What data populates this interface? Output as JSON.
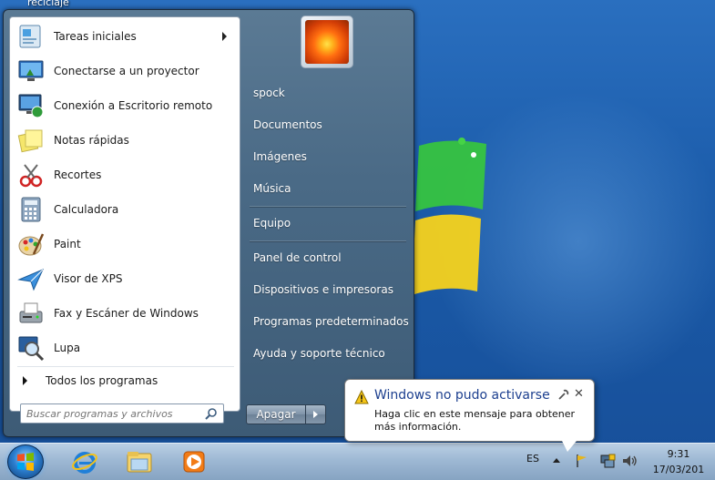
{
  "desktop": {
    "icon_label": "reciclaje"
  },
  "start_menu": {
    "programs": [
      {
        "label": "Tareas iniciales",
        "icon": "getting-started-icon",
        "has_submenu": true
      },
      {
        "label": "Conectarse a un proyector",
        "icon": "projector-icon",
        "has_submenu": false
      },
      {
        "label": "Conexión a Escritorio remoto",
        "icon": "remote-desktop-icon",
        "has_submenu": false
      },
      {
        "label": "Notas rápidas",
        "icon": "sticky-notes-icon",
        "has_submenu": false
      },
      {
        "label": "Recortes",
        "icon": "snipping-tool-icon",
        "has_submenu": false
      },
      {
        "label": "Calculadora",
        "icon": "calculator-icon",
        "has_submenu": false
      },
      {
        "label": "Paint",
        "icon": "paint-icon",
        "has_submenu": false
      },
      {
        "label": "Visor de XPS",
        "icon": "xps-viewer-icon",
        "has_submenu": false
      },
      {
        "label": "Fax y Escáner de Windows",
        "icon": "fax-scanner-icon",
        "has_submenu": false
      },
      {
        "label": "Lupa",
        "icon": "magnifier-icon",
        "has_submenu": false
      }
    ],
    "all_programs": "Todos los programas",
    "search_placeholder": "Buscar programas y archivos",
    "right_items": [
      {
        "label": "spock"
      },
      {
        "label": "Documentos"
      },
      {
        "label": "Imágenes"
      },
      {
        "label": "Música"
      },
      {
        "label": "Equipo"
      },
      {
        "label": "Panel de control"
      },
      {
        "label": "Dispositivos e impresoras"
      },
      {
        "label": "Programas predeterminados"
      },
      {
        "label": "Ayuda y soporte técnico"
      }
    ],
    "shutdown_label": "Apagar"
  },
  "taskbar": {
    "language": "ES",
    "time": "9:31",
    "date": "17/03/201"
  },
  "notification": {
    "title": "Windows no pudo activarse",
    "message": "Haga clic en este mensaje para obtener más información."
  },
  "colors": {
    "desktop": "#1a5aa8",
    "menu_frame": "#4a6a86",
    "balloon_title": "#1c3f8f"
  }
}
